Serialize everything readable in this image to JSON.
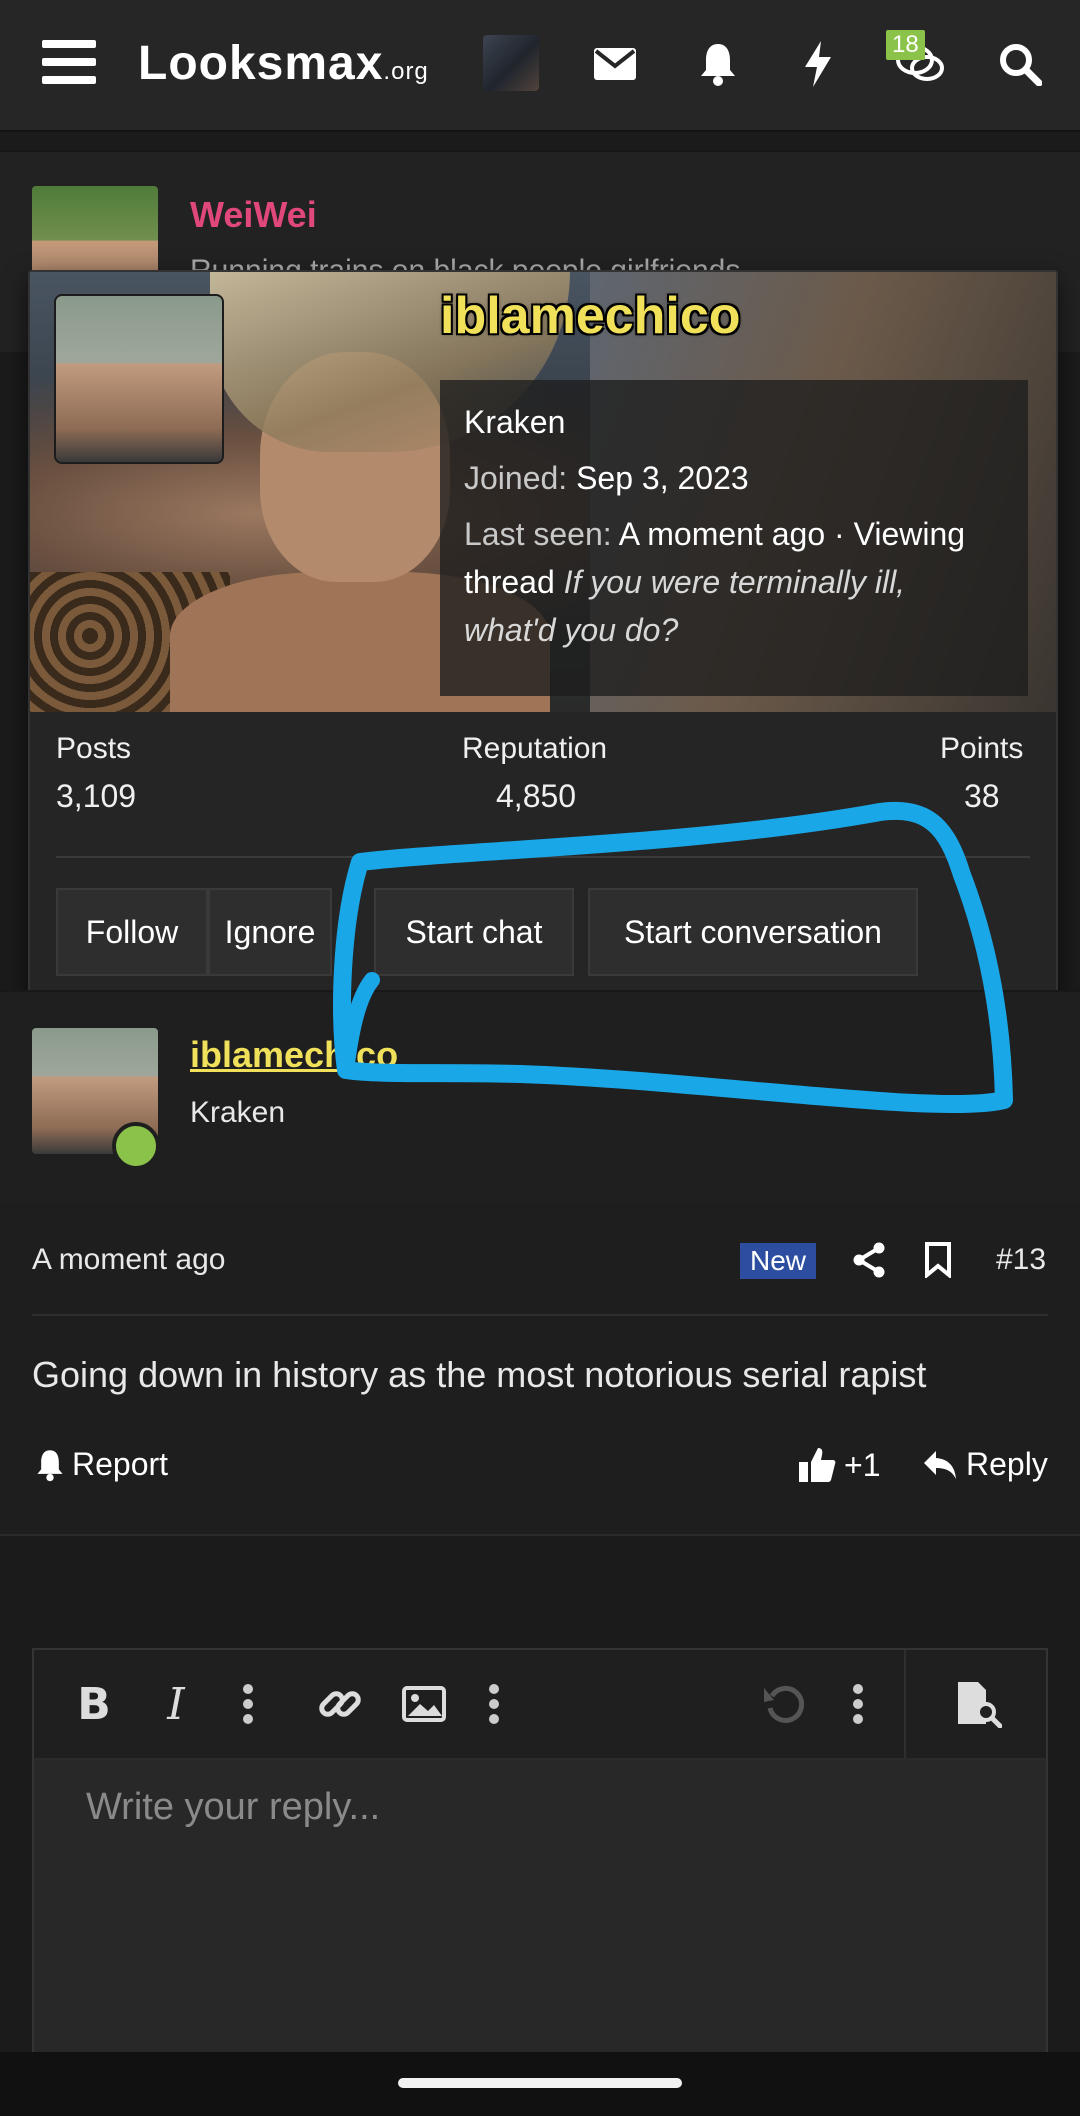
{
  "nav": {
    "logo_main": "Looksmax",
    "logo_suffix": ".org",
    "messages_badge": "18"
  },
  "background_post": {
    "username": "WeiWei",
    "subtitle": "Running trains on black people girlfriends"
  },
  "member_card": {
    "username": "iblamechico",
    "title": "Kraken",
    "joined_label": "Joined:",
    "joined_value": "Sep 3, 2023",
    "last_seen_label": "Last seen:",
    "last_seen_value": "A moment ago · Viewing",
    "viewing_prefix": "thread",
    "viewing_thread_line1": "If you were terminally ill,",
    "viewing_thread_line2": "what'd you do?",
    "stats": {
      "posts_label": "Posts",
      "posts_value": "3,109",
      "reputation_label": "Reputation",
      "reputation_value": "4,850",
      "points_label": "Points",
      "points_value": "38"
    },
    "buttons": {
      "follow": "Follow",
      "ignore": "Ignore",
      "start_chat": "Start chat",
      "start_conversation": "Start conversation"
    }
  },
  "post": {
    "username": "iblamechico",
    "user_title": "Kraken",
    "time": "A moment ago",
    "new_badge": "New",
    "post_number": "#13",
    "body": "Going down in history as the most notorious serial rapist",
    "report_label": "Report",
    "like_label": "+1",
    "reply_label": "Reply"
  },
  "editor": {
    "placeholder": "Write your reply..."
  },
  "colors": {
    "background": "#1b1b1b",
    "accent_username": "#f0e05a",
    "weiwei_name": "#e0487c",
    "online": "#8bc34a",
    "new_badge": "#2d4ea0",
    "annotation": "#1aa7e8"
  }
}
